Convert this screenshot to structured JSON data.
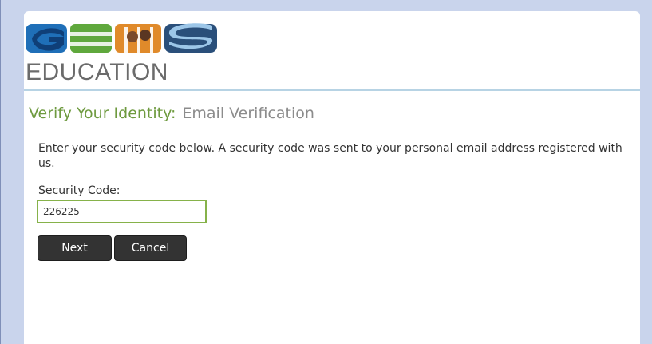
{
  "logo": {
    "brand": "GEMS",
    "subtitle": "EDUCATION",
    "colors": {
      "blue": "#1f6fb8",
      "green": "#5fa83c",
      "orange": "#e08a2a",
      "dark": "#2a4f7a"
    }
  },
  "page": {
    "title": "Verify Your Identity:",
    "subtitle": "Email Verification"
  },
  "form": {
    "instructions": "Enter your security code below. A security code was sent to your personal email address registered with us.",
    "code_label": "Security Code:",
    "code_value": "226225"
  },
  "buttons": {
    "next": "Next",
    "cancel": "Cancel"
  }
}
